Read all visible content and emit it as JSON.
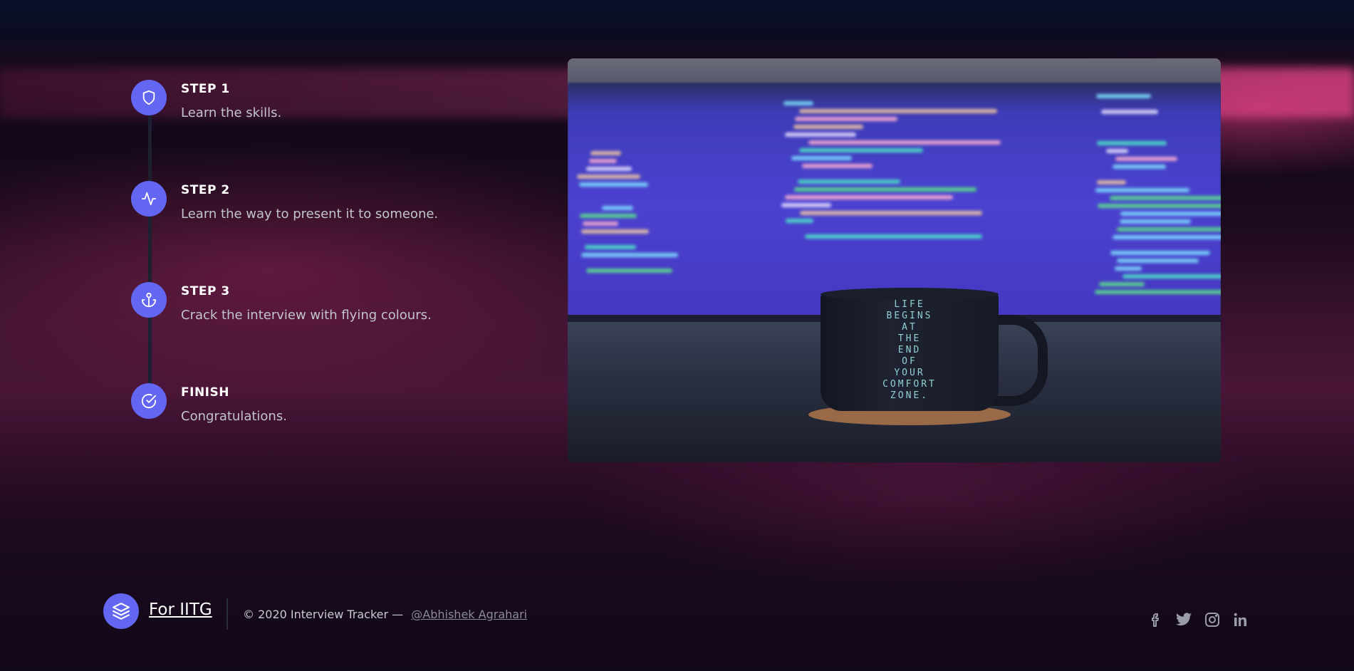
{
  "steps": [
    {
      "icon": "shield-icon",
      "title": "STEP 1",
      "description": "Learn the skills."
    },
    {
      "icon": "activity-icon",
      "title": "STEP 2",
      "description": "Learn the way to present it to someone."
    },
    {
      "icon": "anchor-icon",
      "title": "STEP 3",
      "description": "Crack the interview with flying colours."
    },
    {
      "icon": "check-circle-icon",
      "title": "FINISH",
      "description": "Congratulations."
    }
  ],
  "photo": {
    "mug_text": [
      "LIFE",
      "BEGINS",
      "AT",
      "THE",
      "END",
      "OF",
      "YOUR",
      "COMFORT",
      "ZONE."
    ]
  },
  "footer": {
    "logo_icon": "layers-icon",
    "brand": "For IITG",
    "copyright": "© 2020 Interview Tracker —",
    "author": "@Abhishek Agrahari",
    "social": [
      "facebook-icon",
      "twitter-icon",
      "instagram-icon",
      "linkedin-icon"
    ]
  },
  "colors": {
    "accent": "#6366f1",
    "text_primary": "#ffffff",
    "text_muted": "#c2c4cc"
  }
}
